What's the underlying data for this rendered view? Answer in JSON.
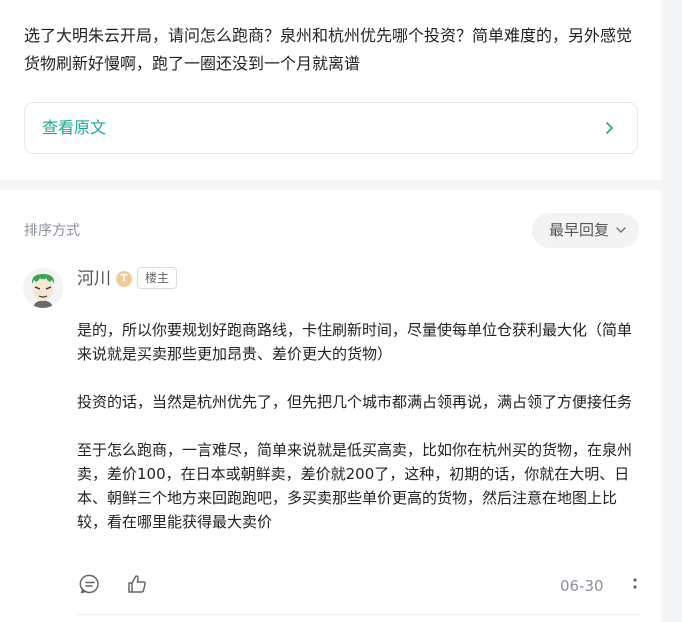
{
  "question": {
    "text": "选了大明朱云开局，请问怎么跑商？泉州和杭州优先哪个投资？简单难度的，另外感觉货物刷新好慢啊，跑了一圈还没到一个月就离谱",
    "view_original_label": "查看原文"
  },
  "comments_header": {
    "sort_label": "排序方式",
    "sort_selected": "最早回复"
  },
  "comment": {
    "username": "河川",
    "level_badge": "T",
    "op_badge": "楼主",
    "paragraphs": [
      "是的，所以你要规划好跑商路线，卡住刷新时间，尽量使每单位仓获利最大化（简单来说就是买卖那些更加昂贵、差价更大的货物）",
      "投资的话，当然是杭州优先了，但先把几个城市都满占领再说，满占领了方便接任务",
      "至于怎么跑商，一言难尽，简单来说就是低买高卖，比如你在杭州买的货物，在泉州卖，差价100，在日本或朝鲜卖，差价就200了，这种，初期的话，你就在大明、日本、朝鲜三个地方来回跑跑吧，多买卖那些单价更高的货物，然后注意在地图上比较，看在哪里能获得最大卖价"
    ],
    "date": "06-30"
  },
  "colors": {
    "accent": "#1aa896",
    "muted_text": "#8a8f99",
    "background": "#f4f5f7"
  }
}
